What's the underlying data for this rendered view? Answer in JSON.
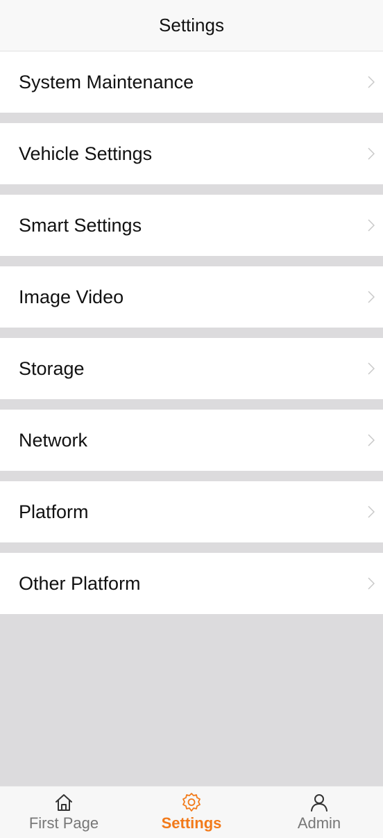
{
  "header": {
    "title": "Settings"
  },
  "menu": {
    "items": [
      {
        "label": "System Maintenance"
      },
      {
        "label": "Vehicle Settings"
      },
      {
        "label": "Smart Settings"
      },
      {
        "label": "Image Video"
      },
      {
        "label": "Storage"
      },
      {
        "label": "Network"
      },
      {
        "label": "Platform"
      },
      {
        "label": "Other Platform"
      }
    ]
  },
  "tabbar": {
    "tabs": [
      {
        "label": "First Page",
        "icon": "home-icon",
        "active": false
      },
      {
        "label": "Settings",
        "icon": "gear-icon",
        "active": true
      },
      {
        "label": "Admin",
        "icon": "user-icon",
        "active": false
      }
    ]
  },
  "colors": {
    "accent": "#f27a1a",
    "background": "#dcdbdd",
    "inactive": "#777777"
  }
}
